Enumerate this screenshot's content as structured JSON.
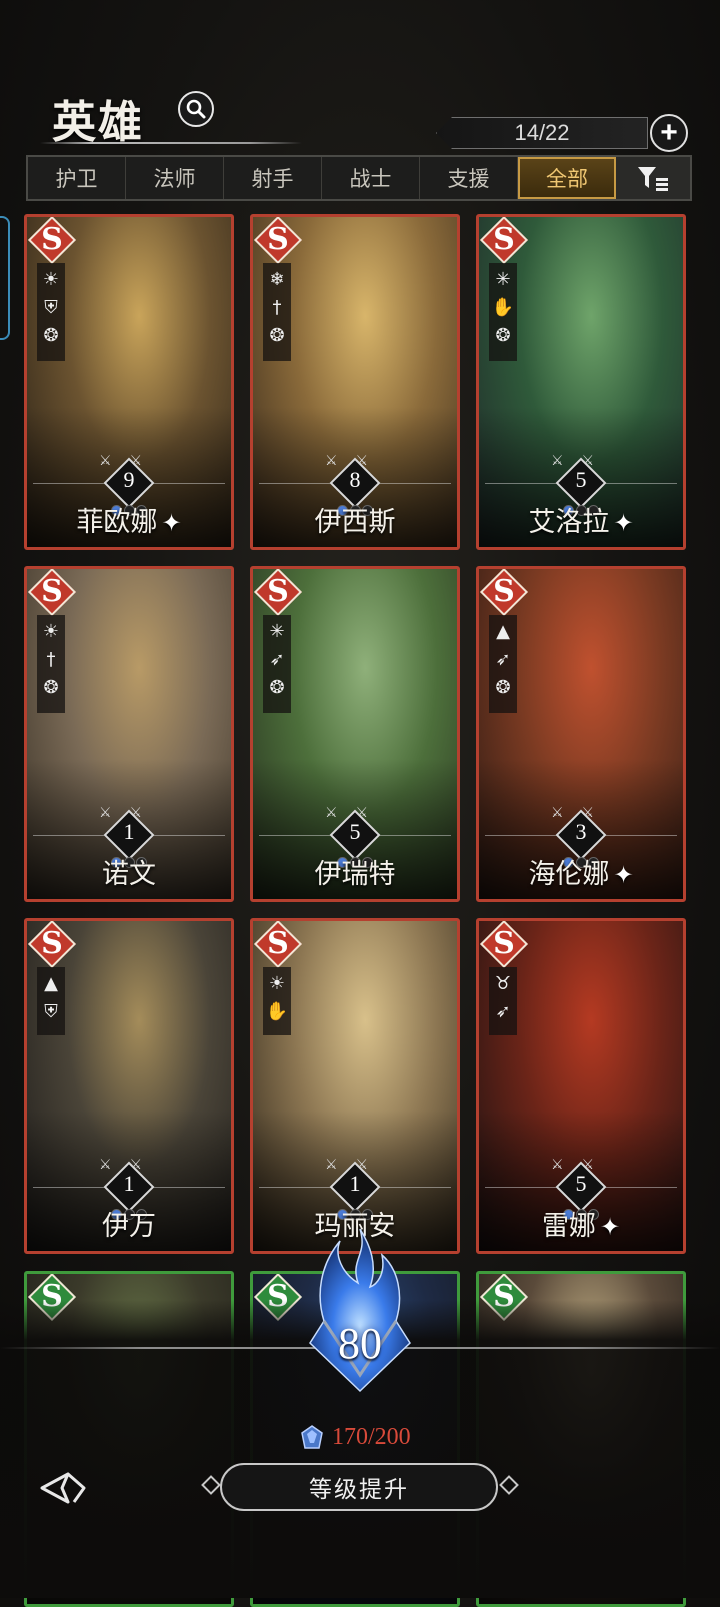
{
  "header": {
    "title": "英雄",
    "hero_count": "14/22"
  },
  "tabs": [
    {
      "label": "护卫",
      "active": false
    },
    {
      "label": "法师",
      "active": false
    },
    {
      "label": "射手",
      "active": false
    },
    {
      "label": "战士",
      "active": false
    },
    {
      "label": "支援",
      "active": false
    },
    {
      "label": "全部",
      "active": true
    }
  ],
  "heroes": [
    {
      "name": "菲欧娜",
      "rank": "S",
      "level": "9",
      "star": "✦",
      "icons": [
        "sun-icon",
        "shield-icon",
        "crest-icon"
      ],
      "frame": "#b5402f",
      "bg": [
        "#c9a45a",
        "#6b5330",
        "#2a2116"
      ]
    },
    {
      "name": "伊西斯",
      "rank": "S",
      "level": "8",
      "star": "",
      "icons": [
        "snowflake-icon",
        "dagger-icon",
        "crest-icon"
      ],
      "frame": "#b5402f",
      "bg": [
        "#d8b56a",
        "#8a6a3a",
        "#3a2b1c"
      ]
    },
    {
      "name": "艾洛拉",
      "rank": "S",
      "level": "5",
      "star": "✦",
      "icons": [
        "burst-icon",
        "palm-icon",
        "crest-icon"
      ],
      "frame": "#b5402f",
      "bg": [
        "#6fa46a",
        "#2f5a3a",
        "#1f2a2a"
      ]
    },
    {
      "name": "诺文",
      "rank": "S",
      "level": "1",
      "star": "",
      "icons": [
        "sun-icon",
        "dagger-icon",
        "crest-icon"
      ],
      "frame": "#b5402f",
      "bg": [
        "#b89a66",
        "#7a6a56",
        "#3b3328"
      ]
    },
    {
      "name": "伊瑞特",
      "rank": "S",
      "level": "5",
      "star": "",
      "icons": [
        "burst-icon",
        "bow-icon",
        "crest-icon"
      ],
      "frame": "#b5402f",
      "bg": [
        "#8fb07a",
        "#4d6f3b",
        "#27321f"
      ]
    },
    {
      "name": "海伦娜",
      "rank": "S",
      "level": "3",
      "star": "✦",
      "icons": [
        "triangle-icon",
        "bow-icon",
        "crest-icon"
      ],
      "frame": "#b5402f",
      "bg": [
        "#c0512f",
        "#7a3a22",
        "#2d1b14"
      ]
    },
    {
      "name": "伊万",
      "rank": "S",
      "level": "1",
      "star": "",
      "icons": [
        "triangle-icon",
        "shield-icon"
      ],
      "frame": "#b5402f",
      "bg": [
        "#a48c5a",
        "#4a4438",
        "#1e1c1a"
      ]
    },
    {
      "name": "玛丽安",
      "rank": "S",
      "level": "1",
      "star": "",
      "icons": [
        "sun-icon",
        "palm-icon"
      ],
      "frame": "#b5402f",
      "bg": [
        "#d8c08a",
        "#8c7652",
        "#2f261a"
      ]
    },
    {
      "name": "雷娜",
      "rank": "S",
      "level": "5",
      "star": "✦",
      "icons": [
        "horns-icon",
        "bow-icon"
      ],
      "frame": "#b5402f",
      "bg": [
        "#b53a22",
        "#6a2418",
        "#1c1212"
      ]
    },
    {
      "name": "",
      "rank": "S",
      "level": "",
      "star": "",
      "icons": [],
      "frame": "#3f9b3c",
      "bg": [
        "#6b7a4a",
        "#3b3a2a",
        "#1e1d18"
      ]
    },
    {
      "name": "",
      "rank": "S",
      "level": "",
      "star": "",
      "icons": [],
      "frame": "#3f9b3c",
      "bg": [
        "#2b4a7a",
        "#1e2a44",
        "#14161c"
      ]
    },
    {
      "name": "",
      "rank": "S",
      "level": "",
      "star": "",
      "icons": [],
      "frame": "#3f9b3c",
      "bg": [
        "#c9b68a",
        "#5a4a3a",
        "#1e1a16"
      ]
    }
  ],
  "footer": {
    "player_level": "80",
    "resource": "170/200",
    "upgrade_label": "等级提升"
  },
  "colors": {
    "accent_gold": "#c79a44",
    "rank_red": "#c0392b",
    "resource_red": "#d84a3a",
    "flame_blue": "#3a7bea"
  }
}
